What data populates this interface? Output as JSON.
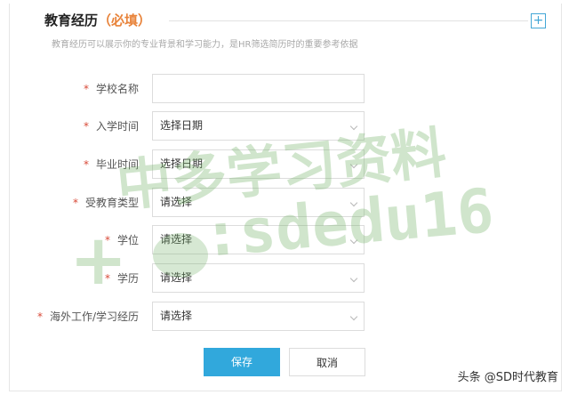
{
  "section": {
    "title": "教育经历",
    "required": "（必填）",
    "add_symbol": "+",
    "hint": "教育经历可以展示你的专业背景和学习能力，是HR筛选简历时的重要参考依据"
  },
  "form": {
    "required_mark": "*",
    "fields": [
      {
        "label": "学校名称",
        "value": "",
        "type": "input"
      },
      {
        "label": "入学时间",
        "value": "选择日期",
        "type": "select"
      },
      {
        "label": "毕业时间",
        "value": "选择日期",
        "type": "select"
      },
      {
        "label": "受教育类型",
        "value": "请选择",
        "type": "select"
      },
      {
        "label": "学位",
        "value": "请选择",
        "type": "select"
      },
      {
        "label": "学历",
        "value": "请选择",
        "type": "select"
      },
      {
        "label": "海外工作/学习经历",
        "value": "请选择",
        "type": "select"
      }
    ]
  },
  "buttons": {
    "save": "保存",
    "cancel": "取消"
  },
  "watermark": {
    "line1": "中多学习资料",
    "line2": ":sdedu16",
    "plus": "+"
  },
  "credit": "头条 @SD时代教育",
  "colors": {
    "accent": "#31a8dc",
    "required_star": "#d84a38",
    "required_text": "#e8833a",
    "watermark": "#78b46e"
  }
}
